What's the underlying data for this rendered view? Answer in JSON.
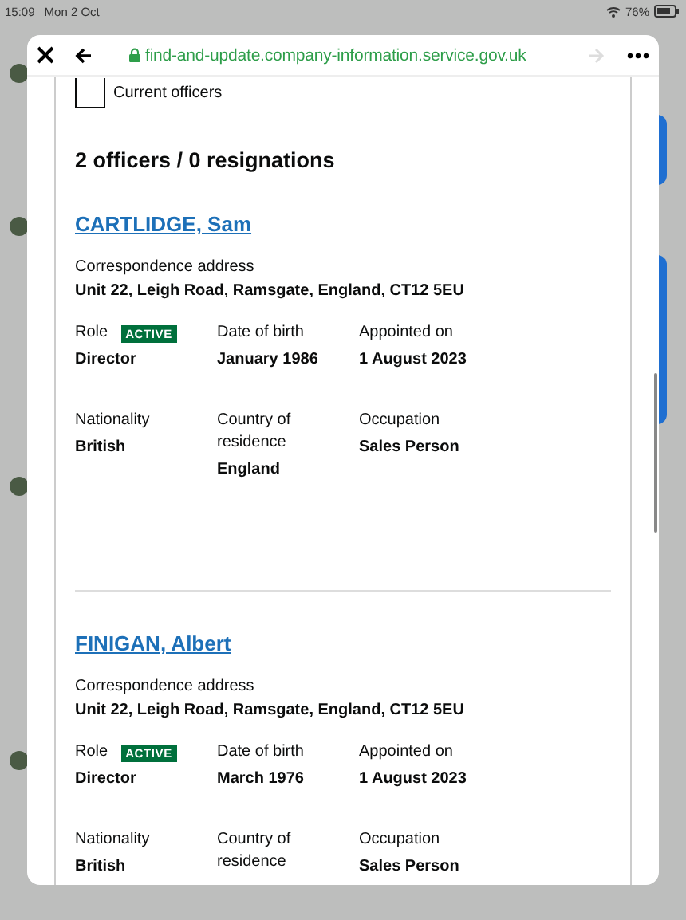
{
  "status_bar": {
    "time": "15:09",
    "date": "Mon 2 Oct",
    "battery": "76%"
  },
  "browser": {
    "url": "find-and-update.company-information.service.gov.uk",
    "secure": true,
    "forward_disabled": true
  },
  "filter": {
    "label": "Current officers",
    "checked": false
  },
  "heading": "2 officers / 0 resignations",
  "officers": [
    {
      "name": "CARTLIDGE, Sam",
      "address_label": "Correspondence address",
      "address": "Unit 22, Leigh Road, Ramsgate, England, CT12 5EU",
      "fields": [
        {
          "label": "Role",
          "status": "ACTIVE",
          "value": "Director"
        },
        {
          "label": "Date of birth",
          "value": "January 1986"
        },
        {
          "label": "Appointed on",
          "value": "1 August 2023"
        },
        {
          "label": "Nationality",
          "value": "British"
        },
        {
          "label": "Country of residence",
          "value": "England"
        },
        {
          "label": "Occupation",
          "value": "Sales Person"
        }
      ]
    },
    {
      "name": "FINIGAN, Albert",
      "address_label": "Correspondence address",
      "address": "Unit 22, Leigh Road, Ramsgate, England, CT12 5EU",
      "fields": [
        {
          "label": "Role",
          "status": "ACTIVE",
          "value": "Director"
        },
        {
          "label": "Date of birth",
          "value": "March 1976"
        },
        {
          "label": "Appointed on",
          "value": "1 August 2023"
        },
        {
          "label": "Nationality",
          "value": "British"
        },
        {
          "label": "Country of residence"
        },
        {
          "label": "Occupation",
          "value": "Sales Person"
        }
      ]
    }
  ]
}
